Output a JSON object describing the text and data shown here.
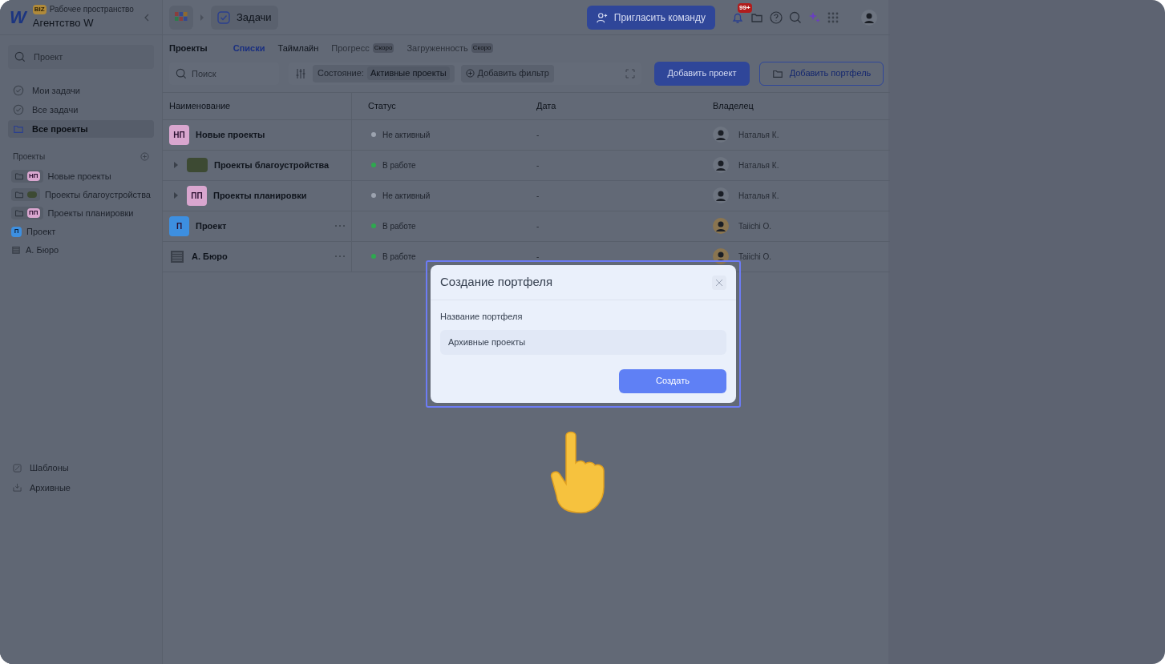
{
  "workspace": {
    "logo": "W",
    "badge": "BIZ",
    "label": "Рабочее пространство",
    "name": "Агентство W"
  },
  "topbar": {
    "breadcrumb": "Задачи",
    "invite": "Пригласить команду",
    "notifications": "99+"
  },
  "sidebar": {
    "search_placeholder": "Проект",
    "nav": [
      {
        "label": "Мои задачи",
        "selected": false,
        "kind": "check"
      },
      {
        "label": "Все задачи",
        "selected": false,
        "kind": "check"
      },
      {
        "label": "Все проекты",
        "selected": true,
        "kind": "folder"
      }
    ],
    "section": "Проекты",
    "projects": [
      {
        "label": "Новые проекты",
        "kind": "portfolio",
        "avatar": "НП",
        "color": "#d9a6cf"
      },
      {
        "label": "Проекты благоустройства",
        "kind": "portfolio_photo"
      },
      {
        "label": "Проекты планировки",
        "kind": "portfolio",
        "avatar": "ПП",
        "color": "#d9a6cf"
      },
      {
        "label": "Проект",
        "kind": "project",
        "avatar": "П",
        "color": "#3d8fe0"
      },
      {
        "label": "А. Бюро",
        "kind": "building"
      }
    ],
    "bottom": [
      {
        "label": "Шаблоны",
        "kind": "templates"
      },
      {
        "label": "Архивные",
        "kind": "archive"
      }
    ]
  },
  "view": {
    "title": "Проекты",
    "tabs": [
      {
        "label": "Списки",
        "selected": true,
        "disabled": false
      },
      {
        "label": "Таймлайн",
        "selected": false,
        "disabled": false
      },
      {
        "label": "Прогресс",
        "selected": false,
        "disabled": true,
        "badge": "Скоро"
      },
      {
        "label": "Загруженность",
        "selected": false,
        "disabled": true,
        "badge": "Скоро"
      }
    ],
    "search_placeholder": "Поиск",
    "filter_label": "Состояние:",
    "filter_value": "Активные проекты",
    "add_filter": "Добавить фильтр",
    "add_project": "Добавить проект",
    "add_portfolio": "Добавить портфель"
  },
  "table": {
    "columns": [
      "Наименование",
      "Статус",
      "Дата",
      "Владелец"
    ],
    "rows": [
      {
        "name": "Новые проекты",
        "avatar": {
          "kind": "initials",
          "text": "НП",
          "color": "#d9a6cf"
        },
        "menu": false,
        "status": {
          "text": "Не активный",
          "color": "#9ca3af"
        },
        "date": "-",
        "owner": "Наталья К.",
        "children": [
          {
            "name": "Проекты благоустройства",
            "avatar": {
              "kind": "photo"
            },
            "expanded": false,
            "menu": false,
            "status": {
              "text": "В работе",
              "color": "#2fa84f"
            },
            "date": "-",
            "owner": "Наталья К."
          },
          {
            "name": "Проекты планировки",
            "avatar": {
              "kind": "initials",
              "text": "ПП",
              "color": "#d9a6cf"
            },
            "expanded": false,
            "menu": false,
            "status": {
              "text": "Не активный",
              "color": "#9ca3af"
            },
            "date": "-",
            "owner": "Наталья К."
          }
        ]
      },
      {
        "name": "Проект",
        "avatar": {
          "kind": "initials",
          "text": "П",
          "color": "#3d8fe0"
        },
        "menu": true,
        "status": {
          "text": "В работе",
          "color": "#2fa84f"
        },
        "date": "-",
        "owner": "Taiichi O."
      },
      {
        "name": "А. Бюро",
        "avatar": {
          "kind": "building"
        },
        "menu": true,
        "status": {
          "text": "В работе",
          "color": "#2fa84f"
        },
        "date": "-",
        "owner": "Taiichi O."
      }
    ]
  },
  "dialog": {
    "title": "Создание портфеля",
    "field_label": "Название портфеля",
    "field_value": "Архивные проекты",
    "submit": "Создать"
  }
}
